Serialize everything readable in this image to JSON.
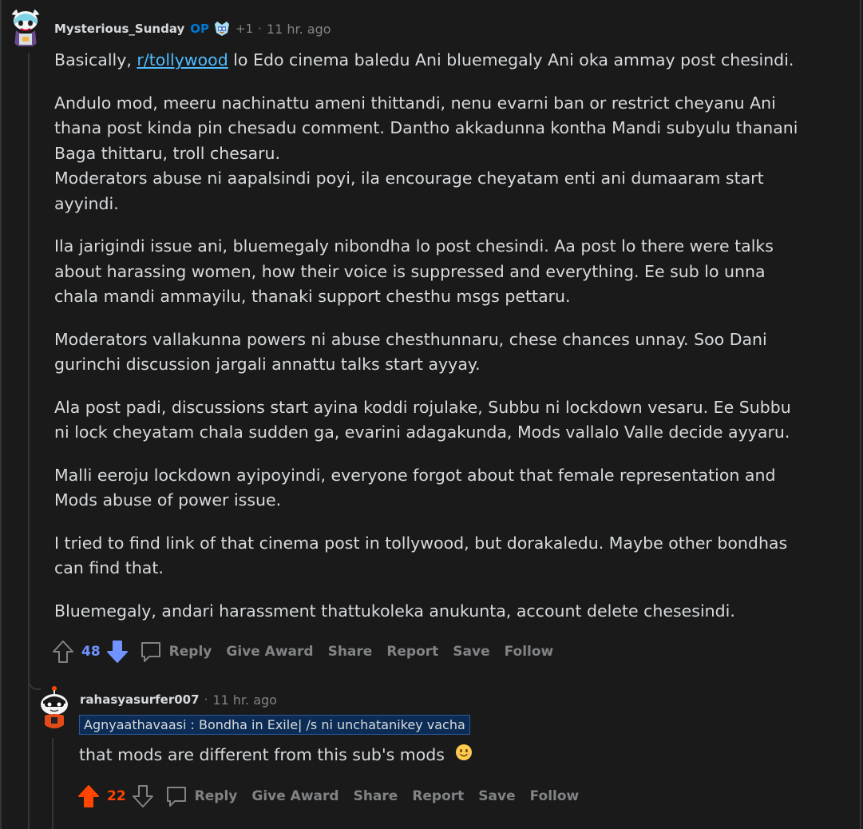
{
  "comment1": {
    "username": "Mysterious_Sunday",
    "op_label": "OP",
    "plus_awards": "+1",
    "separator": "·",
    "time": "11 hr. ago",
    "p1_before": "Basically, ",
    "p1_link": "r/tollywood",
    "p1_after": " lo Edo cinema baledu Ani bluemegaly Ani oka ammay post chesindi.",
    "p2_line1": "Andulo mod, meeru nachinattu ameni thittandi, nenu evarni ban or restrict cheyanu Ani thana post kinda pin chesadu comment. Dantho akkadunna kontha Mandi subyulu thanani Baga thittaru, troll chesaru.",
    "p2_line2": "Moderators abuse ni aapalsindi poyi, ila encourage cheyatam enti ani dumaaram start ayyindi.",
    "p3": "Ila jarigindi issue ani, bluemegaly nibondha lo post chesindi. Aa post lo there were talks about harassing women, how their voice is suppressed and everything. Ee sub lo unna chala mandi ammayilu, thanaki support chesthu msgs pettaru.",
    "p4": "Moderators vallakunna powers ni abuse chesthunnaru, chese chances unnay. Soo Dani gurinchi discussion jargali annattu talks start ayyay.",
    "p5": "Ala post padi, discussions start ayina koddi rojulake, Subbu ni lockdown vesaru. Ee Subbu ni lock cheyatam chala sudden ga, evarini adagakunda, Mods vallalo Valle decide ayyaru.",
    "p6": "Malli eeroju lockdown ayipoyindi, everyone forgot about that female representation and Mods abuse of power issue.",
    "p7": "I tried to find link of that cinema post in tollywood, but dorakaledu. Maybe other bondhas can find that.",
    "p8": "Bluemegaly, andari harassment thattukoleka anukunta, account delete chesesindi.",
    "score": "48"
  },
  "comment2": {
    "username": "rahasyasurfer007",
    "separator": "·",
    "time": "11 hr. ago",
    "flair": "Agnyaathavaasi : Bondha in Exile| /s ni unchatanikey vacha",
    "text": "that mods are different from this sub's mods",
    "emoji": "slightly-smiling-face",
    "score": "22"
  },
  "actions": {
    "reply": "Reply",
    "give_award": "Give Award",
    "share": "Share",
    "report": "Report",
    "save": "Save",
    "follow": "Follow"
  },
  "colors": {
    "background": "#1a1a1b",
    "text": "#d7dadc",
    "muted": "#818384",
    "link": "#4fbcff",
    "op": "#0079d3",
    "downvoted": "#7193ff",
    "upvoted": "#ff4500",
    "flair_bg": "#0c2c55"
  }
}
